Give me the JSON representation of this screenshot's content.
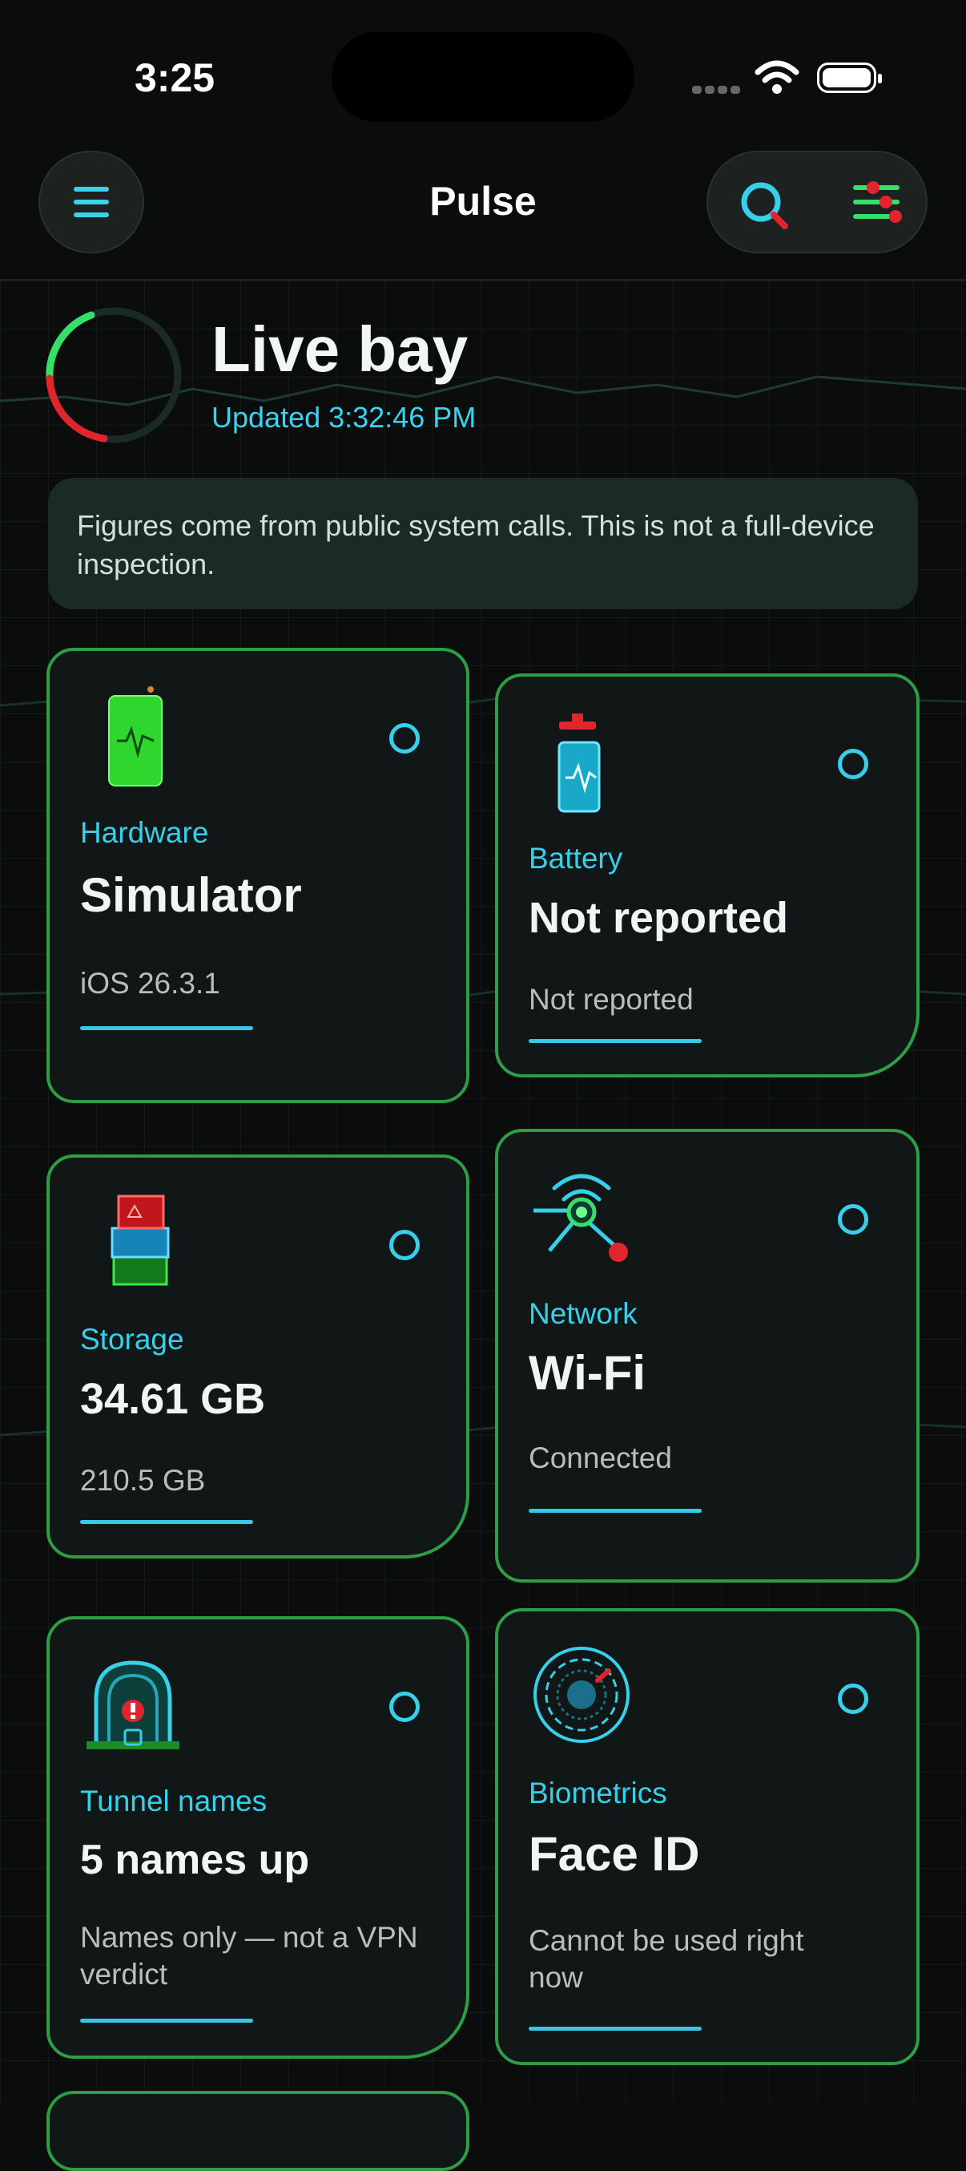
{
  "status_bar": {
    "time": "3:25"
  },
  "nav": {
    "title": "Pulse"
  },
  "hero": {
    "title": "Live bay",
    "updated": "Updated 3:32:46 PM"
  },
  "notice": {
    "text": "Figures come from public system calls. This is not a full-device inspection."
  },
  "cards": [
    {
      "label": "Hardware",
      "value": "Simulator",
      "sub": "iOS 26.3.1",
      "icon": "phone-icon"
    },
    {
      "label": "Battery",
      "value": "Not reported",
      "sub": "Not reported",
      "icon": "battery-icon"
    },
    {
      "label": "Storage",
      "value": "34.61 GB",
      "sub": "210.5 GB",
      "icon": "storage-icon"
    },
    {
      "label": "Network",
      "value": "Wi-Fi",
      "sub": "Connected",
      "icon": "network-icon"
    },
    {
      "label": "Tunnel names",
      "value": "5 names up",
      "sub": "Names only — not a VPN verdict",
      "icon": "tunnel-lock-icon"
    },
    {
      "label": "Biometrics",
      "value": "Face ID",
      "sub": "Cannot be used right now",
      "icon": "biometrics-icon"
    }
  ],
  "colors": {
    "accent": "#37d0ea",
    "card_border": "#2e9d43",
    "alert": "#e0252f",
    "ok": "#35e06a"
  }
}
